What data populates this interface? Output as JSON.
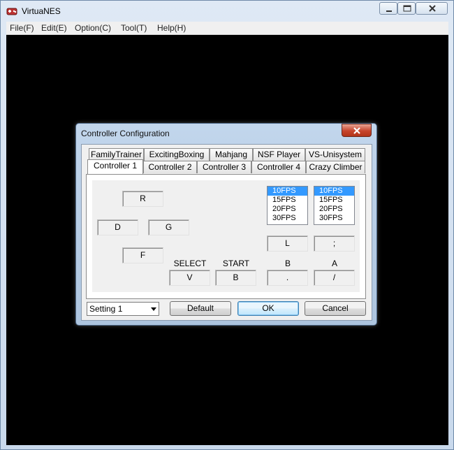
{
  "window": {
    "title": "VirtuaNES",
    "menu": [
      "File(F)",
      "Edit(E)",
      "Option(C)",
      "Tool(T)",
      "Help(H)"
    ]
  },
  "dialog": {
    "title": "Controller Configuration",
    "tabs_row1": [
      "FamilyTrainer",
      "ExcitingBoxing",
      "Mahjang",
      "NSF Player",
      "VS-Unisystem"
    ],
    "tabs_row2": [
      "Controller 1",
      "Controller 2",
      "Controller 3",
      "Controller 4",
      "Crazy Climber"
    ],
    "active_tab": "Controller 1",
    "dpad": {
      "up": "R",
      "left": "D",
      "right": "G",
      "down": "F"
    },
    "labels": {
      "select": "SELECT",
      "start": "START",
      "b": "B",
      "a": "A"
    },
    "keys": {
      "select": "V",
      "start": "B",
      "turbo_b": "L",
      "turbo_a": ";",
      "b": ".",
      "a": "/"
    },
    "turbo_b_rates": [
      "10FPS",
      "15FPS",
      "20FPS",
      "30FPS"
    ],
    "turbo_a_rates": [
      "10FPS",
      "15FPS",
      "20FPS",
      "30FPS"
    ],
    "turbo_b_selected": "10FPS",
    "turbo_a_selected": "10FPS",
    "setting_select": "Setting 1",
    "buttons": {
      "default": "Default",
      "ok": "OK",
      "cancel": "Cancel"
    }
  },
  "colors": {
    "selection": "#3399ff",
    "client_bg": "#000000",
    "close_red": "#c7452c"
  },
  "icons": {
    "app": "nes-controller-icon",
    "close": "close-icon",
    "minimize": "minimize-icon",
    "maximize": "maximize-icon"
  }
}
